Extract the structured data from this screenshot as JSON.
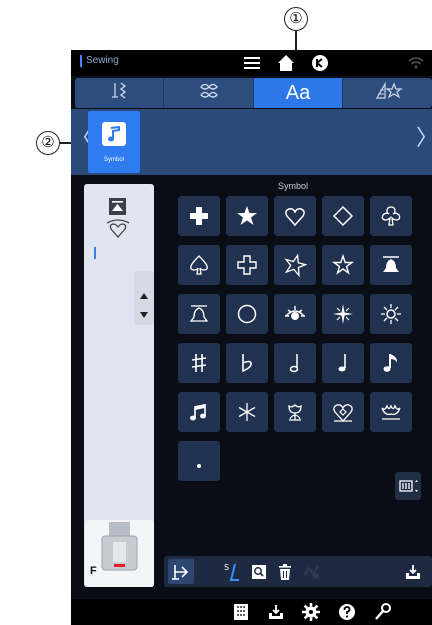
{
  "status_bar": {
    "app_label": "Sewing",
    "icons": [
      "menu-icon",
      "home-icon",
      "bobbin-winder-icon",
      "wifi-icon"
    ]
  },
  "tabs": [
    {
      "id": "utility",
      "icon": "utility-stitch-icon",
      "active": false
    },
    {
      "id": "decorative",
      "icon": "decorative-stitch-icon",
      "active": false
    },
    {
      "id": "letters",
      "label": "Aa",
      "active": true
    },
    {
      "id": "favorites",
      "icon": "favorite-stitch-icon",
      "active": false
    }
  ],
  "category_strip": {
    "prev_glyph": "〈",
    "next_glyph": "〉",
    "selected_category": {
      "label": "Symbol",
      "icon": "music-note-icon"
    }
  },
  "pattern_panel": {
    "title": "Symbol",
    "patterns": [
      "plus-bold",
      "star-solid",
      "heart-outline",
      "diamond-outline",
      "club-outline",
      "spade-outline",
      "plus-outline",
      "star-outline",
      "star-outline-small",
      "bell-solid",
      "bell-outline",
      "circle-outline",
      "sun-half",
      "sparkle",
      "sunburst",
      "sharp",
      "flat",
      "half-note",
      "quarter-note",
      "eighth-note",
      "beamed-notes",
      "asterisk",
      "tulip",
      "heart-diamond",
      "crown-outline",
      "period"
    ]
  },
  "left_panel": {
    "foot_label": "F"
  },
  "colors": {
    "screen_bg": "#0a0d16",
    "tab_bar": "#2d4d7e",
    "active_tab": "#2c78e8",
    "pattern_cell": "#203250",
    "panel_light": "#dfe6ef",
    "accent_red": "#e02020"
  },
  "callouts": [
    {
      "number": "①"
    },
    {
      "number": "②"
    }
  ]
}
